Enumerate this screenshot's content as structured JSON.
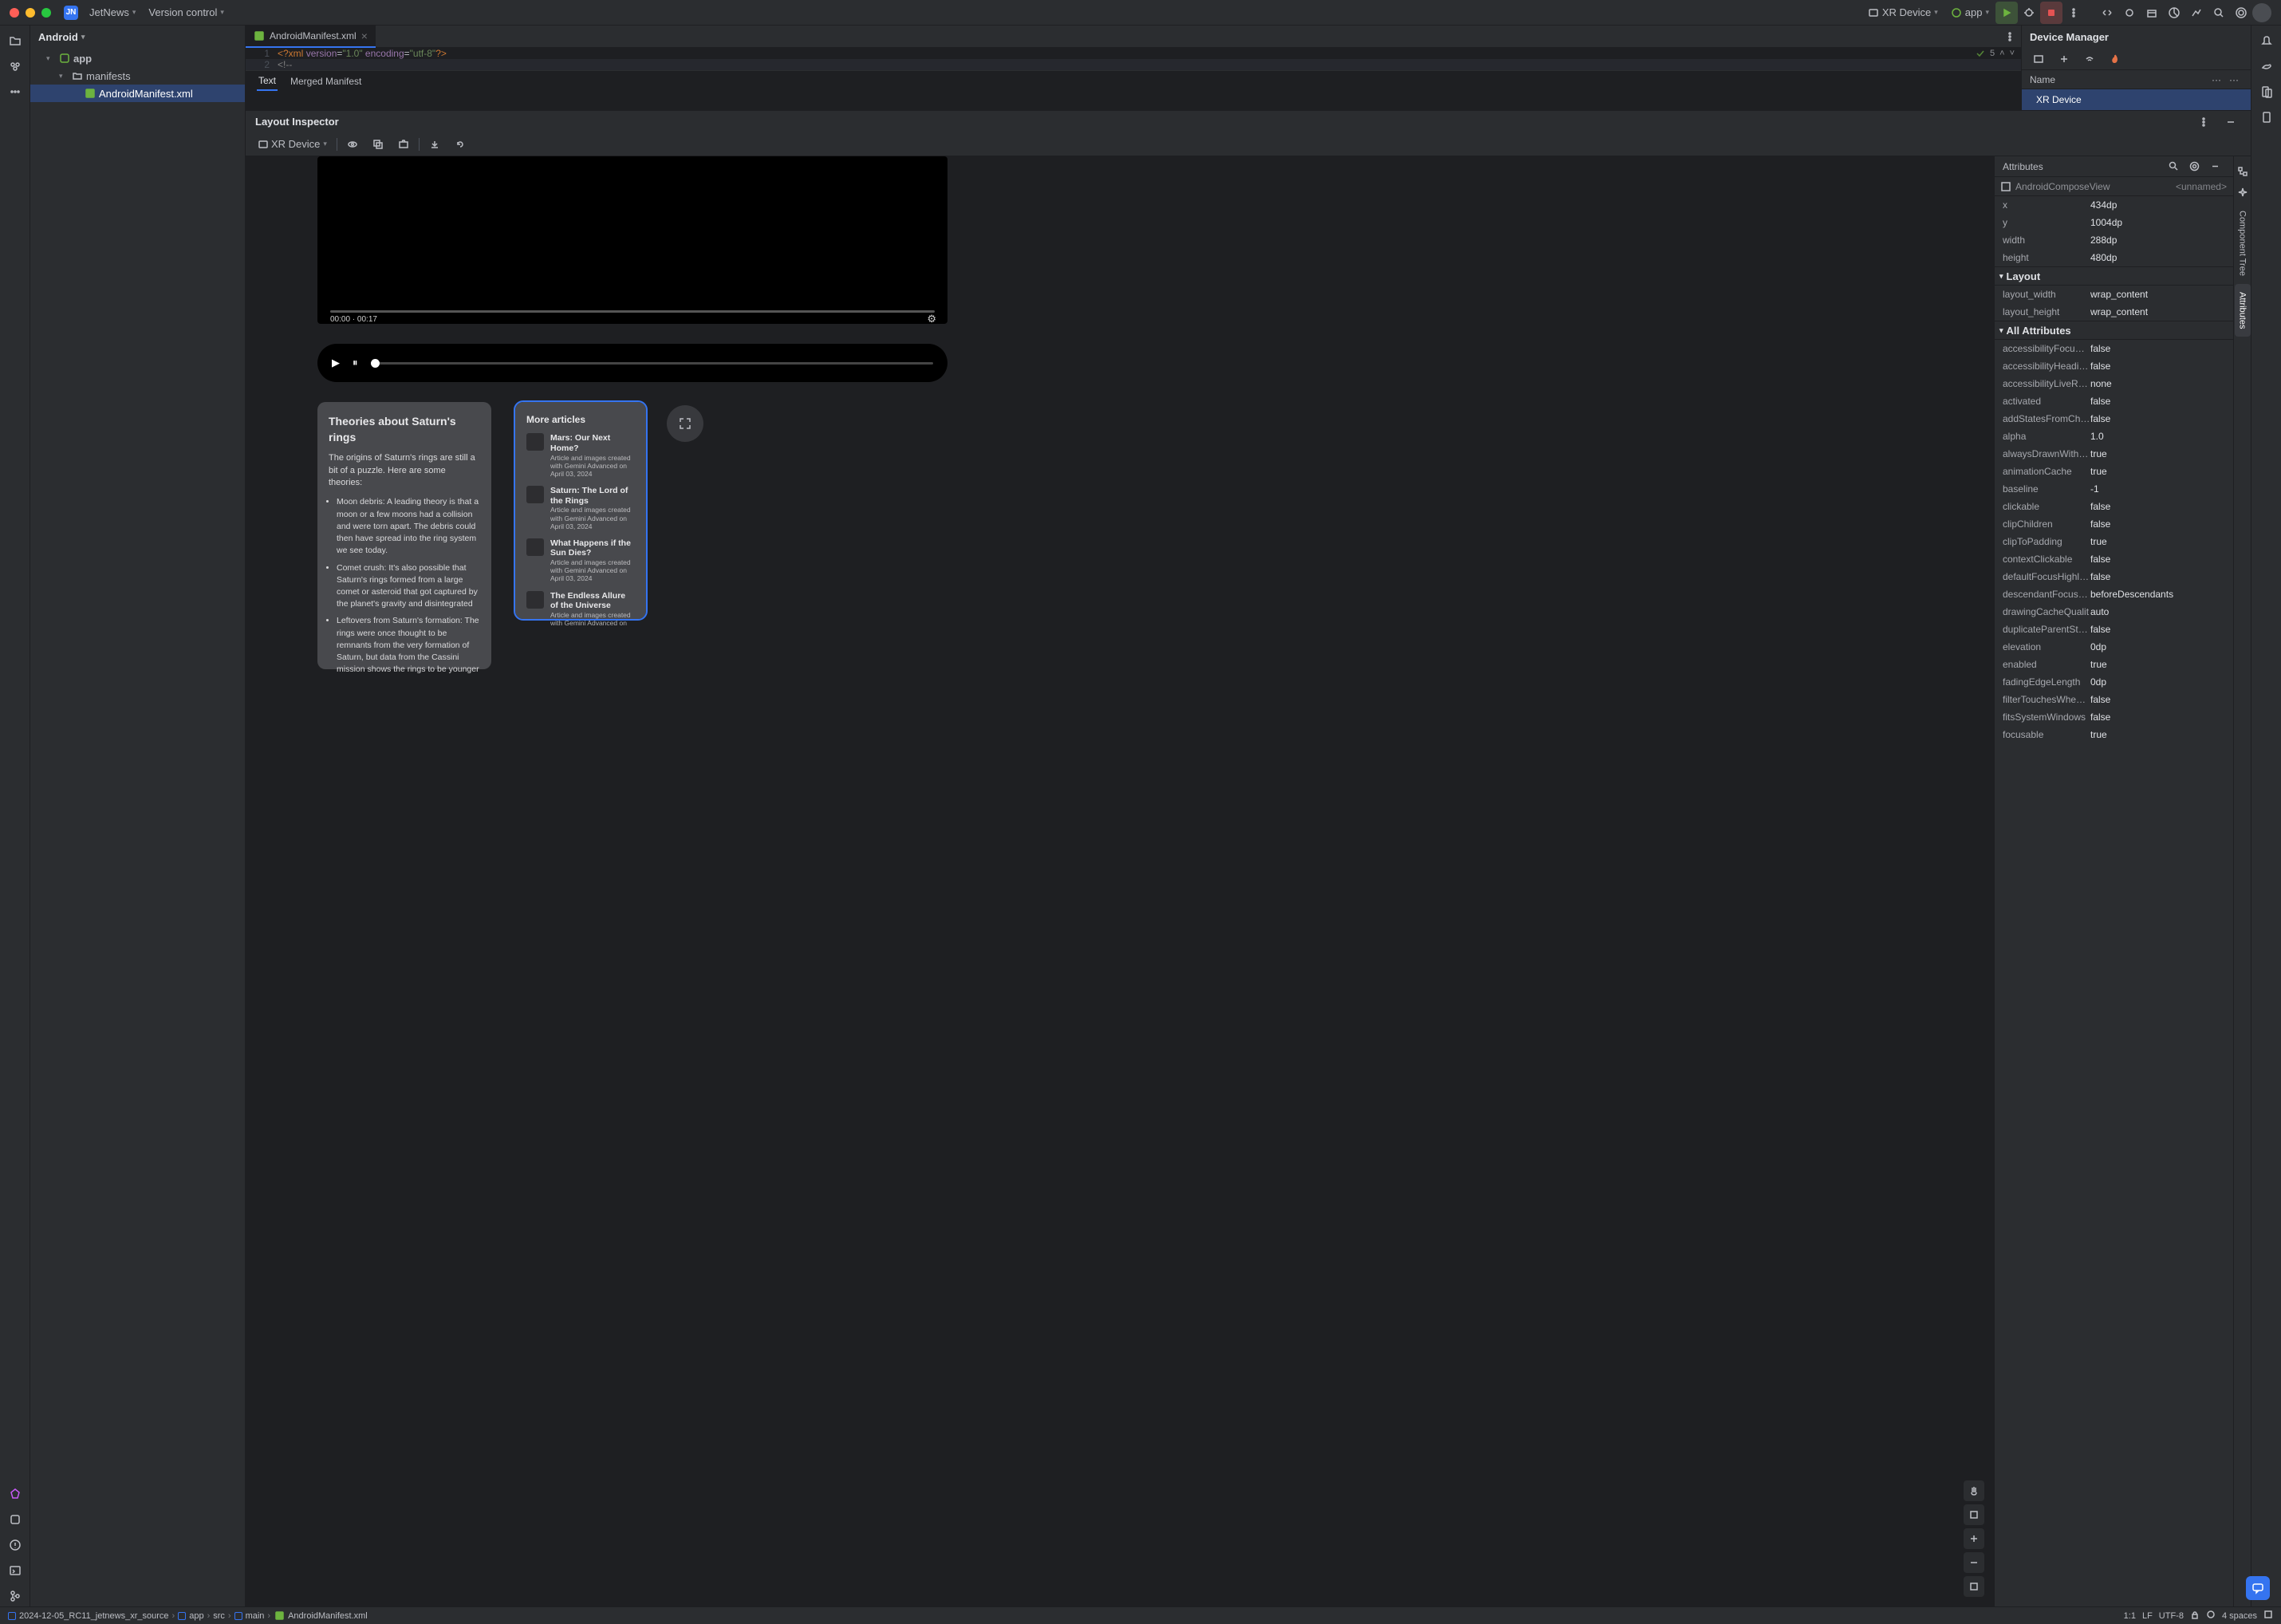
{
  "titlebar": {
    "project": "JetNews",
    "badge": "JN",
    "vcs": "Version control",
    "device": "XR Device",
    "config": "app",
    "problems_count": "5"
  },
  "projectView": {
    "title": "Android",
    "nodes": {
      "app": "app",
      "manifests": "manifests",
      "manifest": "AndroidManifest.xml"
    }
  },
  "editor": {
    "tab": "AndroidManifest.xml",
    "line1_pre": "<?xml ",
    "line1_attr1": "version",
    "line1_val1": "\"1.0\"",
    "line1_attr2": " encoding",
    "line1_val2": "\"utf-8\"",
    "line1_post": "?>",
    "line2": "<!--",
    "subtab_text": "Text",
    "subtab_merged": "Merged Manifest"
  },
  "deviceManager": {
    "title": "Device Manager",
    "col_name": "Name",
    "col_dots1": "···",
    "col_dots2": "···",
    "row": "XR Device"
  },
  "layoutInspector": {
    "title": "Layout Inspector",
    "device": "XR Device"
  },
  "attributes": {
    "title": "Attributes",
    "widget": "AndroidComposeView",
    "unnamed": "<unnamed>",
    "sec_layout": "Layout",
    "sec_all": "All Attributes",
    "basic": [
      {
        "k": "x",
        "v": "434dp"
      },
      {
        "k": "y",
        "v": "1004dp"
      },
      {
        "k": "width",
        "v": "288dp"
      },
      {
        "k": "height",
        "v": "480dp"
      }
    ],
    "layout": [
      {
        "k": "layout_width",
        "v": "wrap_content"
      },
      {
        "k": "layout_height",
        "v": "wrap_content"
      }
    ],
    "all": [
      {
        "k": "accessibilityFocu…",
        "v": "false"
      },
      {
        "k": "accessibilityHeadi…",
        "v": "false"
      },
      {
        "k": "accessibilityLiveR…",
        "v": "none"
      },
      {
        "k": "activated",
        "v": "false"
      },
      {
        "k": "addStatesFromCh…",
        "v": "false"
      },
      {
        "k": "alpha",
        "v": "1.0"
      },
      {
        "k": "alwaysDrawnWith…",
        "v": "true"
      },
      {
        "k": "animationCache",
        "v": "true"
      },
      {
        "k": "baseline",
        "v": "-1"
      },
      {
        "k": "clickable",
        "v": "false"
      },
      {
        "k": "clipChildren",
        "v": "false"
      },
      {
        "k": "clipToPadding",
        "v": "true"
      },
      {
        "k": "contextClickable",
        "v": "false"
      },
      {
        "k": "defaultFocusHighli…",
        "v": "false"
      },
      {
        "k": "descendantFocus…",
        "v": "beforeDescendants"
      },
      {
        "k": "drawingCacheQualit",
        "v": "auto"
      },
      {
        "k": "duplicateParentSt…",
        "v": "false"
      },
      {
        "k": "elevation",
        "v": "0dp"
      },
      {
        "k": "enabled",
        "v": "true"
      },
      {
        "k": "fadingEdgeLength",
        "v": "0dp"
      },
      {
        "k": "filterTouchesWhe…",
        "v": "false"
      },
      {
        "k": "fitsSystemWindows",
        "v": "false"
      },
      {
        "k": "focusable",
        "v": "true"
      }
    ]
  },
  "canvas": {
    "video_time": "00:00  ·  00:17",
    "card1": {
      "title": "Theories about Saturn's rings",
      "intro": "The origins of Saturn's rings are still a bit of a puzzle. Here are some theories:",
      "b1": "Moon debris: A leading theory is that a moon or a few moons had a collision and were torn apart. The debris could then have spread into the ring system we see today.",
      "b2": "Comet crush: It's also possible that Saturn's rings formed from a large comet or asteroid that got captured by the planet's gravity and disintegrated",
      "b3": "Leftovers from Saturn's formation: The rings were once thought to be remnants from the very formation of Saturn, but data from the Cassini mission shows the rings to be younger"
    },
    "card2": {
      "title": "More articles",
      "arts": [
        {
          "t": "Mars: Our Next Home?",
          "s": "Article and images created with Gemini Advanced on April 03, 2024"
        },
        {
          "t": "Saturn: The Lord of the Rings",
          "s": "Article and images created with Gemini Advanced on April 03, 2024"
        },
        {
          "t": "What Happens if the Sun Dies?",
          "s": "Article and images created with Gemini Advanced on April 03, 2024"
        },
        {
          "t": "The Endless Allure of the Universe",
          "s": "Article and images created with Gemini Advanced on"
        }
      ]
    }
  },
  "sidetabs": {
    "tree": "Component Tree",
    "attrs": "Attributes"
  },
  "status": {
    "crumbs": [
      "2024-12-05_RC11_jetnews_xr_source",
      "app",
      "src",
      "main",
      "AndroidManifest.xml"
    ],
    "pos": "1:1",
    "le": "LF",
    "enc": "UTF-8",
    "indent": "4 spaces"
  }
}
